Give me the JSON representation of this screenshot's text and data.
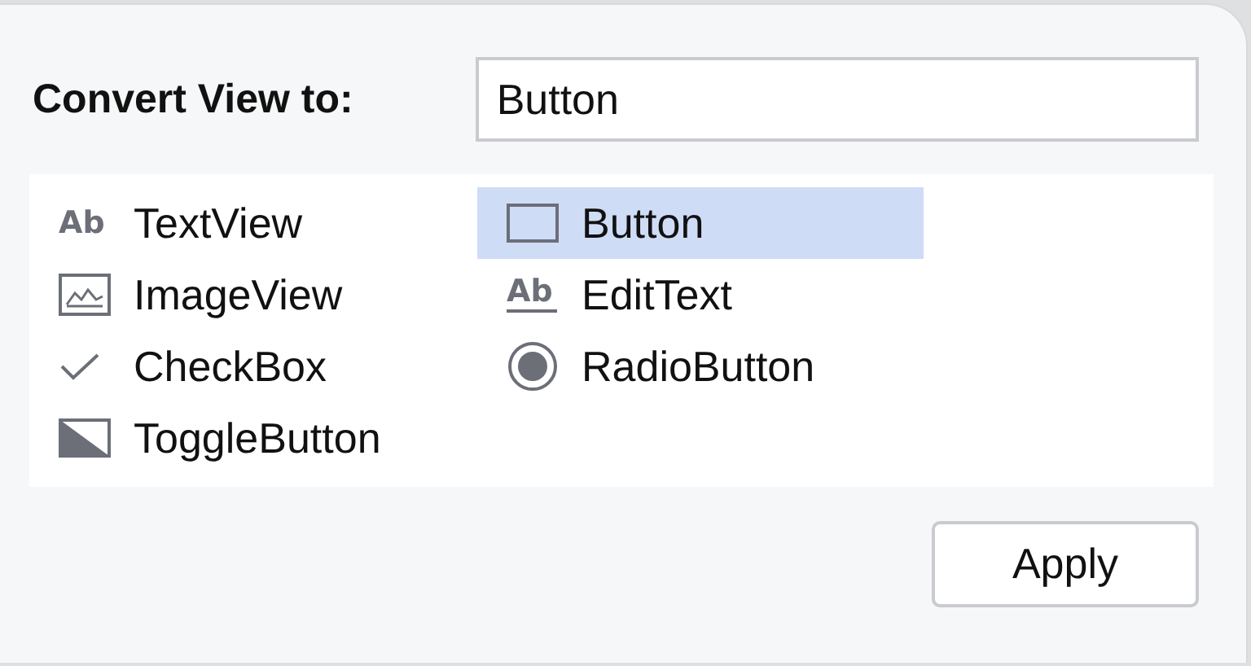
{
  "label": "Convert View to:",
  "field": {
    "value": "Button"
  },
  "columns": [
    [
      {
        "kind": "text",
        "icon_text": "Ab",
        "label": "TextView",
        "selected": false
      },
      {
        "kind": "image",
        "label": "ImageView",
        "selected": false
      },
      {
        "kind": "check",
        "label": "CheckBox",
        "selected": false
      },
      {
        "kind": "toggle",
        "label": "ToggleButton",
        "selected": false
      }
    ],
    [
      {
        "kind": "button",
        "label": "Button",
        "selected": true
      },
      {
        "kind": "edit",
        "icon_text": "Ab",
        "label": "EditText",
        "selected": false
      },
      {
        "kind": "radio",
        "label": "RadioButton",
        "selected": false
      }
    ]
  ],
  "apply": "Apply"
}
